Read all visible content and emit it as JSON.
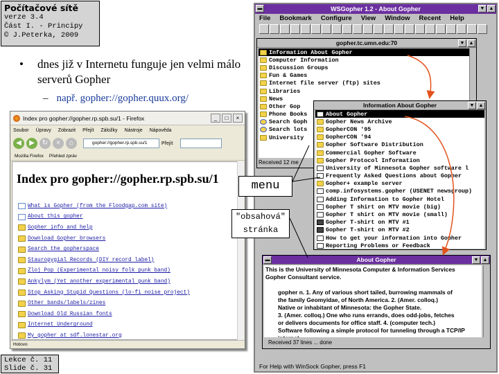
{
  "header": {
    "title": "Počítačové sítě",
    "version": "verze 3.4",
    "part": "Část I. - Principy",
    "author": "© J.Peterka, 2009"
  },
  "footer": {
    "lesson": "Lekce č. 11",
    "slide": "Slide č. 31"
  },
  "bullets": {
    "main": "dnes již v Internetu funguje jen velmi málo serverů Gopher",
    "sub": "např. gopher://gopher.quux.org/"
  },
  "firefox": {
    "window_title": "Index pro gopher://gopher.rp.spb.su/1 - Firefox",
    "menu": [
      "Soubor",
      "Úpravy",
      "Zobrazit",
      "Přejít",
      "Záložky",
      "Nástroje",
      "Nápověda"
    ],
    "url": "gopher://gopher.rp.spb.su/1",
    "go_label": "Přejít",
    "bookmarks": [
      "Mozilla Firefox",
      "Přehled zpráv"
    ],
    "heading": "Index pro gopher://gopher.rp.spb.su/1",
    "items": [
      {
        "icon": "doc",
        "label": "What is Gopher (from the Floodgap.com site)"
      },
      {
        "icon": "doc",
        "label": "About this gopher"
      },
      {
        "icon": "folder",
        "label": "Gopher info and help"
      },
      {
        "icon": "folder",
        "label": "Download Gopher browsers"
      },
      {
        "icon": "folder",
        "label": "Search the gopherspace"
      },
      {
        "icon": "folder",
        "label": "Stauropygial Records (DIY record label)"
      },
      {
        "icon": "folder",
        "label": "Zloj Pop (Experimental noisy folk punk band)"
      },
      {
        "icon": "folder",
        "label": "Ankylym (Yet another experimental punk band)"
      },
      {
        "icon": "folder",
        "label": "Stop Asking Stupid Questions (lo-fi noise project)"
      },
      {
        "icon": "folder",
        "label": "Other bands/labels/zines"
      },
      {
        "icon": "folder",
        "label": "Download Old Russian fonts"
      },
      {
        "icon": "folder",
        "label": "Internet Underground"
      },
      {
        "icon": "folder",
        "label": "My gopher at sdf.lonestar.org"
      }
    ],
    "status": "Hotovo"
  },
  "wsgopher": {
    "title": "WSGopher 1.2 - About Gopher",
    "menu": [
      "File",
      "Bookmark",
      "Configure",
      "View",
      "Window",
      "Recent",
      "Help"
    ],
    "status": "For Help with WinSock Gopher, press F1",
    "main_list": {
      "title": "gopher.tc.umn.edu:70",
      "items": [
        {
          "icon": "folder",
          "label": "Information About Gopher",
          "selected": true
        },
        {
          "icon": "folder",
          "label": "Computer Information"
        },
        {
          "icon": "folder",
          "label": "Discussion Groups"
        },
        {
          "icon": "folder",
          "label": "Fun & Games"
        },
        {
          "icon": "folder",
          "label": "Internet file server (ftp) sites"
        },
        {
          "icon": "folder",
          "label": "Libraries"
        },
        {
          "icon": "folder",
          "label": "News"
        },
        {
          "icon": "folder",
          "label": "Other Gop"
        },
        {
          "icon": "folder",
          "label": "Phone Books"
        },
        {
          "icon": "search",
          "label": "Search Goph"
        },
        {
          "icon": "search",
          "label": "Search lots"
        },
        {
          "icon": "folder",
          "label": "University"
        }
      ],
      "status": "Received 12 me"
    },
    "info_list": {
      "title": "Information About Gopher",
      "items": [
        {
          "icon": "doc",
          "label": "About Gopher",
          "selected": true
        },
        {
          "icon": "folder",
          "label": "Gopher News Archive"
        },
        {
          "icon": "folder",
          "label": "GopherCON '95"
        },
        {
          "icon": "folder",
          "label": "GopherCON '94"
        },
        {
          "icon": "folder",
          "label": "Gopher Software Distribution"
        },
        {
          "icon": "folder",
          "label": "Commercial Gopher Software"
        },
        {
          "icon": "folder",
          "label": "Gopher Protocol Information"
        },
        {
          "icon": "doc",
          "label": "University of Minnesota Gopher software l"
        },
        {
          "icon": "doc",
          "label": "Frequently Asked Questions about Gopher"
        },
        {
          "icon": "folder",
          "label": "Gopher+ example server"
        },
        {
          "icon": "doc",
          "label": "comp.infosystems.gopher (USENET newsgroup)"
        },
        {
          "icon": "doc",
          "label": "Adding Information to Gopher Hotel"
        },
        {
          "icon": "doc",
          "label": "Gopher T shirt on MTV movie (big)"
        },
        {
          "icon": "doc",
          "label": "Gopher T shirt on MTV movie (small)"
        },
        {
          "icon": "tel",
          "label": "Gopher T-shirt on MTV #1"
        },
        {
          "icon": "tel",
          "label": "Gopher T-shirt on MTV #2"
        },
        {
          "icon": "doc",
          "label": "How to get your information into Gopher"
        },
        {
          "icon": "doc",
          "label": "Reporting Problems or Feedback"
        }
      ]
    },
    "about": {
      "title": "About Gopher",
      "lines": [
        "This is the University of Minnesota Computer & Information Services",
        "Gopher Consultant service.",
        "",
        "gopher  n.  1. Any of various short tailed, burrowing mammals of",
        "the family Geomyidae, of North America.  2. (Amer. colloq.)",
        "Native or inhabitant of Minnesota: the Gopher State.",
        "3. (Amer. colloq.) One who runs errands, does odd-jobs, fetches",
        "or delivers documents for office staff.  4. (computer tech.)",
        "Software following a simple protocol for tunneling through a TCP/IP",
        "internet."
      ],
      "status": "Received 37 lines ... done"
    }
  },
  "callouts": {
    "menu": "menu",
    "content_1": "\"obsahová\"",
    "content_2": "stránka"
  },
  "colors": {
    "title_bar": "#6b2fa0",
    "link": "#1a1aa6",
    "arrow": "#e2521c"
  }
}
